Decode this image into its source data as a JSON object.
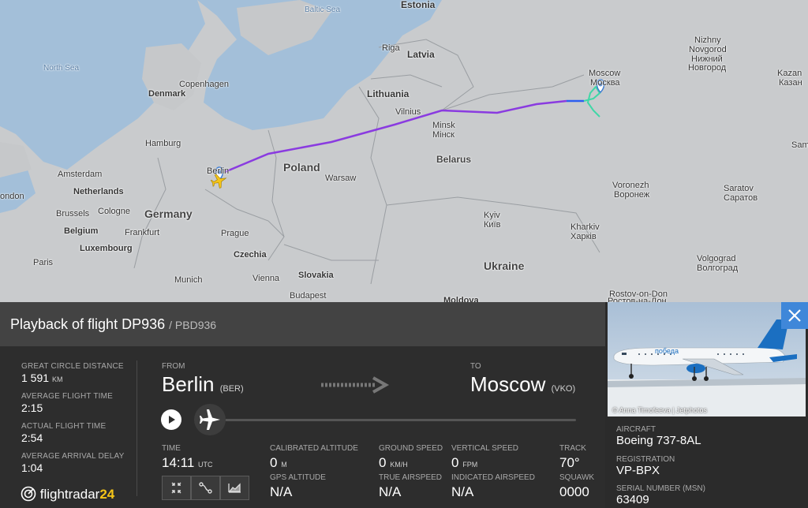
{
  "map": {
    "sea_labels": [
      "Baltic Sea",
      "North Sea"
    ],
    "country_labels": [
      "Germany",
      "Poland",
      "Belarus",
      "Ukraine",
      "Latvia",
      "Lithuania",
      "Estonia",
      "Denmark",
      "Netherlands",
      "Belgium",
      "Luxembourg",
      "Czechia",
      "Slovakia",
      "Moldova"
    ],
    "city_labels": [
      "Riga",
      "Copenhagen",
      "Hamburg",
      "Amsterdam",
      "Brussels",
      "Cologne",
      "Frankfurt",
      "Paris",
      "Prague",
      "Munich",
      "Vienna",
      "Budapest",
      "Warsaw",
      "Vilnius",
      "Minsk",
      "Мінск",
      "Kyiv",
      "Київ",
      "Kharkiv",
      "Харків",
      "Voronezh",
      "Воронеж",
      "Moscow",
      "Москва",
      "Nizhny",
      "Novgorod",
      "Нижний",
      "Новгород",
      "Kazan",
      "Казан",
      "Saratov",
      "Саратов",
      "Volgograd",
      "Волгоград",
      "Rostov-on-Don",
      "Ростов-на-Дон",
      "Sam",
      "ondon",
      "Berlin"
    ]
  },
  "header": {
    "title": "Playback of flight DP936",
    "subtitle": "/ PBD936"
  },
  "stats": {
    "great_circle_label": "GREAT CIRCLE DISTANCE",
    "great_circle_value": "1 591",
    "great_circle_unit": "KM",
    "avg_flight_time_label": "AVERAGE FLIGHT TIME",
    "avg_flight_time_value": "2:15",
    "actual_flight_time_label": "ACTUAL FLIGHT TIME",
    "actual_flight_time_value": "2:54",
    "avg_arrival_delay_label": "AVERAGE ARRIVAL DELAY",
    "avg_arrival_delay_value": "1:04"
  },
  "route": {
    "from_label": "FROM",
    "from_city": "Berlin",
    "from_code": "(BER)",
    "to_label": "TO",
    "to_city": "Moscow",
    "to_code": "(VKO)"
  },
  "playback": {
    "progress": 0.0
  },
  "telemetry": {
    "time_label": "TIME",
    "time_value": "14:11",
    "time_unit": "UTC",
    "cal_alt_label": "CALIBRATED ALTITUDE",
    "cal_alt_value": "0",
    "cal_alt_unit": "M",
    "gps_alt_label": "GPS ALTITUDE",
    "gps_alt_value": "N/A",
    "ground_speed_label": "GROUND SPEED",
    "ground_speed_value": "0",
    "ground_speed_unit": "KM/H",
    "true_airspeed_label": "TRUE AIRSPEED",
    "true_airspeed_value": "N/A",
    "vertical_speed_label": "VERTICAL SPEED",
    "vertical_speed_value": "0",
    "vertical_speed_unit": "FPM",
    "indicated_airspeed_label": "INDICATED AIRSPEED",
    "indicated_airspeed_value": "N/A",
    "track_label": "TRACK",
    "track_value": "70°",
    "squawk_label": "SQUAWK",
    "squawk_value": "0000"
  },
  "aircraft": {
    "aircraft_label": "AIRCRAFT",
    "aircraft_value": "Boeing 737-8AL",
    "registration_label": "REGISTRATION",
    "registration_value": "VP-BPX",
    "serial_label": "SERIAL NUMBER (MSN)",
    "serial_value": "63409",
    "photo_credit": "© Anna Timofeeva | Jetphotos",
    "livery_text": "победа"
  },
  "logo": {
    "brand": "flightradar",
    "brand_num": "24"
  },
  "colors": {
    "accent": "#3f87d9",
    "track_purple": "#8a3be0",
    "track_blue": "#2c5ef0",
    "track_green": "#3fd7a6"
  }
}
